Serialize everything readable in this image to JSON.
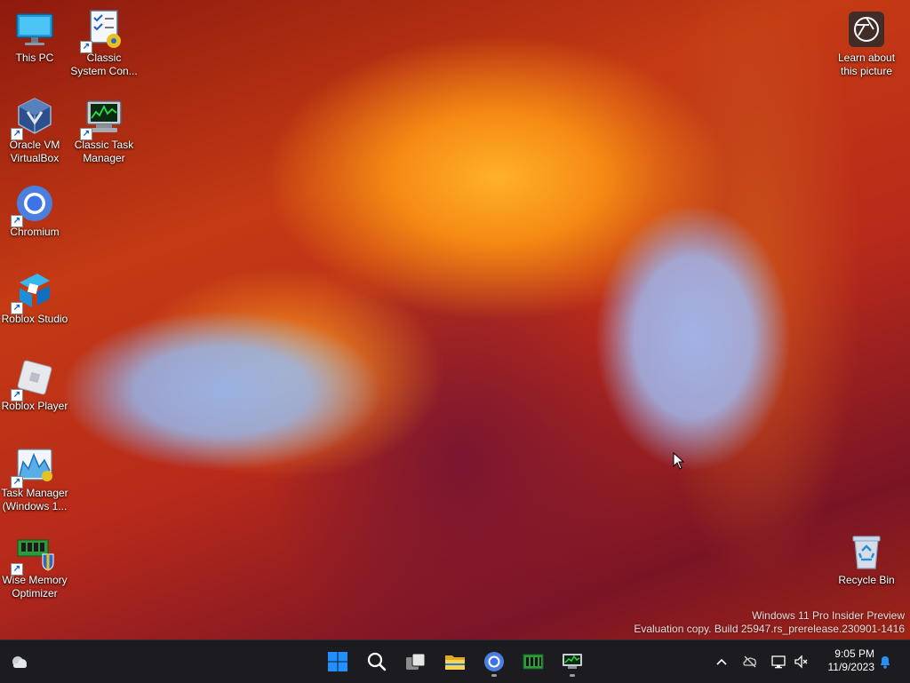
{
  "desktop": {
    "icons": [
      {
        "label": "This PC"
      },
      {
        "label": "Classic System Con..."
      },
      {
        "label": "Oracle VM VirtualBox"
      },
      {
        "label": "Classic Task Manager"
      },
      {
        "label": "Chromium"
      },
      {
        "label": "Roblox Studio"
      },
      {
        "label": "Roblox Player"
      },
      {
        "label": "Task Manager (Windows 1..."
      },
      {
        "label": "Wise Memory Optimizer"
      },
      {
        "label": "Learn about this picture"
      },
      {
        "label": "Recycle Bin"
      }
    ],
    "watermark": {
      "line1": "Windows 11 Pro Insider Preview",
      "line2": "Evaluation copy. Build 25947.rs_prerelease.230901-1416"
    }
  },
  "taskbar": {
    "clock": {
      "time": "9:05 PM",
      "date": "11/9/2023"
    },
    "colors": {
      "background": "#1c1c20",
      "start_blue": "#1e90ff",
      "notification_blue": "#2b8ff0"
    }
  }
}
